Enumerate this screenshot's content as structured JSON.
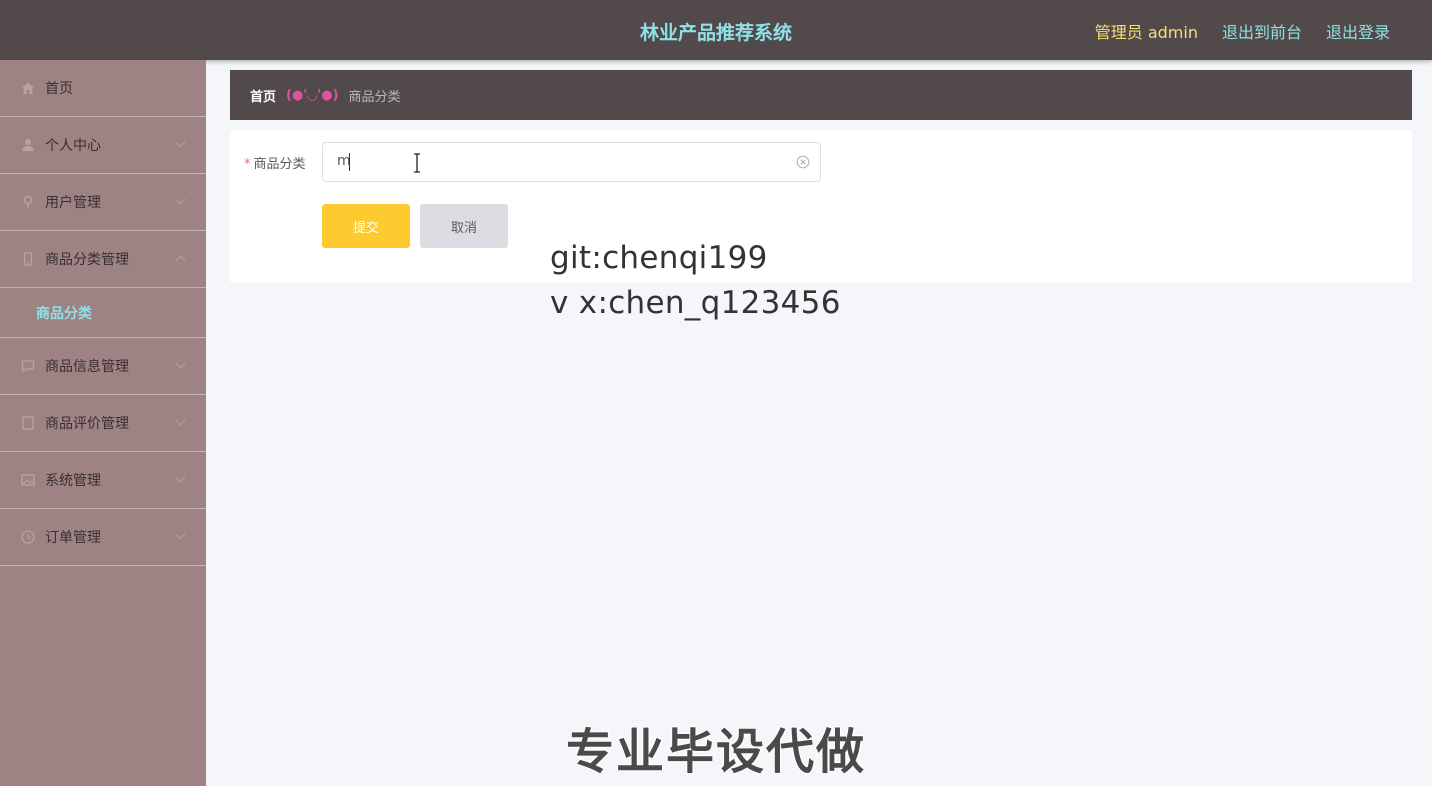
{
  "header": {
    "title": "林业产品推荐系统",
    "admin_label": "管理员 admin",
    "link_front": "退出到前台",
    "link_logout": "退出登录"
  },
  "sidebar": {
    "items": [
      {
        "label": "首页",
        "icon": "home-icon"
      },
      {
        "label": "个人中心",
        "icon": "user-icon"
      },
      {
        "label": "用户管理",
        "icon": "pin-icon"
      },
      {
        "label": "商品分类管理",
        "icon": "phone-icon"
      },
      {
        "label": "商品信息管理",
        "icon": "chat-icon"
      },
      {
        "label": "商品评价管理",
        "icon": "doc-icon"
      },
      {
        "label": "系统管理",
        "icon": "image-icon"
      },
      {
        "label": "订单管理",
        "icon": "clock-icon"
      }
    ],
    "active_sub": "商品分类"
  },
  "breadcrumb": {
    "home": "首页",
    "separator": "(●'◡'●)",
    "current": "商品分类"
  },
  "form": {
    "required_mark": "*",
    "field_label": "商品分类",
    "field_value": "m",
    "submit_label": "提交",
    "cancel_label": "取消"
  },
  "overlay": {
    "line1": "git:chenqi199",
    "line2": "v x:chen_q123456",
    "caption": "专业毕设代做"
  },
  "colors": {
    "topbar": "#524a4a",
    "sidebar": "#9d8383",
    "accent_cyan": "#8fe1e6",
    "accent_yellow": "#f6df73",
    "submit_button": "#fdcb2f",
    "breadcrumb_separator": "#e0529d"
  }
}
